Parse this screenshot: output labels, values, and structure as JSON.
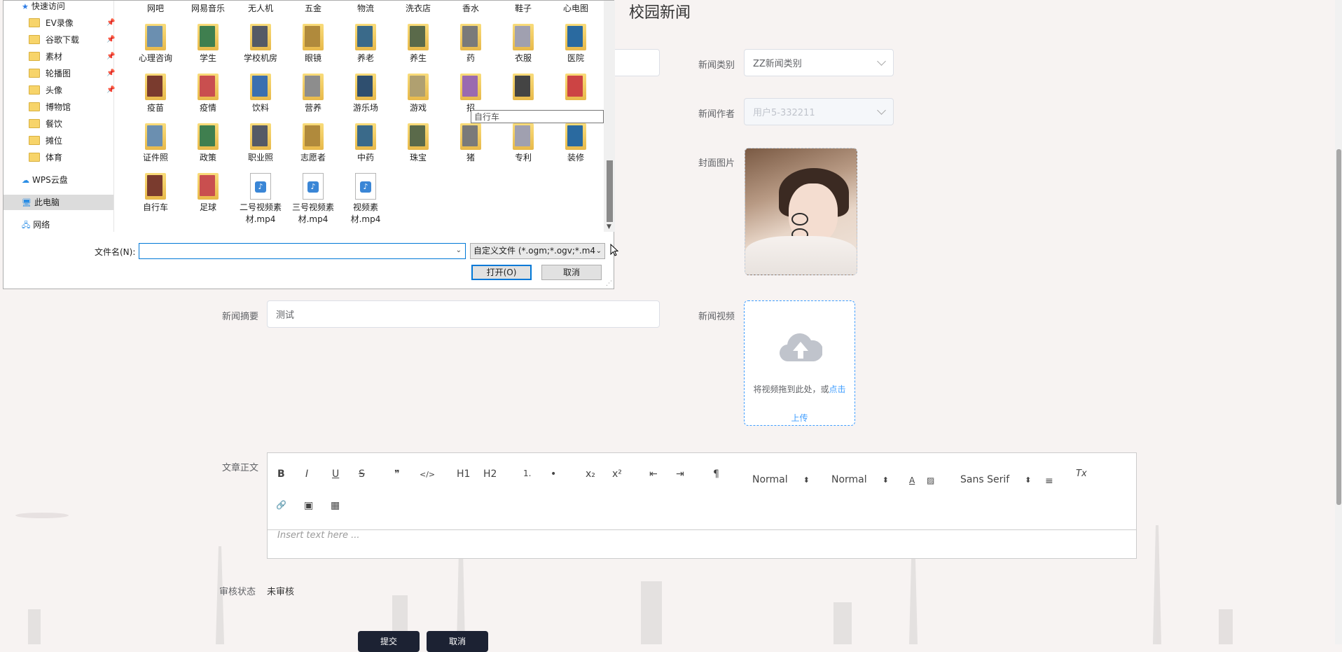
{
  "page": {
    "title": "校园新闻",
    "fields": {
      "category_label": "新闻类别",
      "category_value": "ZZ新闻类别",
      "author_label": "新闻作者",
      "author_value": "用户5-332211",
      "cover_label": "封面图片",
      "summary_label": "新闻摘要",
      "summary_value": "测试",
      "video_label": "新闻视频",
      "video_upload_text": "将视频拖到此处，或",
      "video_upload_link": "点击",
      "video_upload_link2": "上传",
      "content_label": "文章正文",
      "audit_label": "审核状态",
      "audit_value": "未审核"
    },
    "editor": {
      "placeholder": "Insert text here ...",
      "select_size": "Normal",
      "select_header": "Normal",
      "select_font": "Sans Serif",
      "buttons": [
        "B",
        "I",
        "U",
        "S",
        "❞",
        "</>",
        "H1",
        "H2",
        "1.",
        "•",
        "x₂",
        "x²",
        "⇤",
        "⇥",
        "¶",
        "A",
        "▨",
        "≡",
        "Tx",
        "🔗",
        "▣",
        "▦"
      ]
    },
    "bottom_buttons": [
      "提交",
      "取消"
    ]
  },
  "dialog": {
    "nav": [
      {
        "label": "快速访问",
        "icon": "star-icon"
      },
      {
        "label": "EV录像",
        "pinned": true
      },
      {
        "label": "谷歌下载",
        "pinned": true
      },
      {
        "label": "素材",
        "pinned": true
      },
      {
        "label": "轮播图",
        "pinned": true
      },
      {
        "label": "头像",
        "pinned": true
      },
      {
        "label": "博物馆"
      },
      {
        "label": "餐饮"
      },
      {
        "label": "摊位"
      },
      {
        "label": "体育"
      },
      {
        "label": "WPS云盘",
        "icon": "cloud-icon"
      },
      {
        "label": "此电脑",
        "icon": "computer-icon",
        "selected": true
      },
      {
        "label": "网络",
        "icon": "network-icon"
      }
    ],
    "files": [
      "网吧",
      "网易音乐",
      "无人机",
      "五金",
      "物流",
      "洗衣店",
      "香水",
      "鞋子",
      "心电图",
      "心理咨询",
      "学生",
      "学校机房",
      "眼镜",
      "养老",
      "养生",
      "药",
      "衣服",
      "医院",
      "疫苗",
      "疫情",
      "饮料",
      "营养",
      "游乐场",
      "游戏",
      "招",
      "",
      "",
      "证件照",
      "政策",
      "职业照",
      "志愿者",
      "中药",
      "珠宝",
      "猪",
      "专利",
      "装修",
      "自行车",
      "足球",
      "二号视频素材.mp4",
      "三号视频素材.mp4",
      "视频素材.mp4"
    ],
    "tooltip": "自行车",
    "filename_label": "文件名(N):",
    "filename_value": "",
    "filter_value": "自定义文件 (*.ogm;*.ogv;*.m4",
    "open_button": "打开(O)",
    "cancel_button": "取消"
  }
}
